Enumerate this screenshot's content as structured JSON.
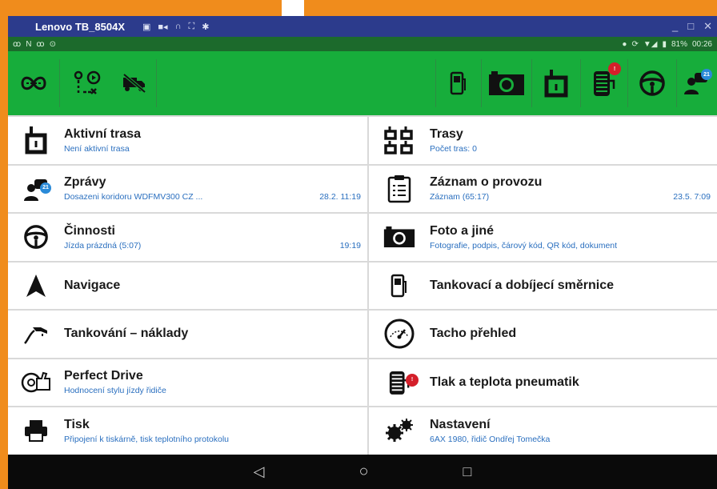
{
  "window": {
    "title": "Lenovo TB_8504X",
    "controls": [
      "_",
      "□",
      "✕"
    ]
  },
  "status": {
    "left_icons": [
      "ꝏ",
      "N",
      "ꝏ",
      "⊙"
    ],
    "battery": "81%",
    "time": "00:26"
  },
  "toolbar": {
    "left": [
      "route-icon",
      "route-planner-icon",
      "no-truck-icon"
    ],
    "right": [
      "fuel-pump-icon",
      "camera-icon",
      "route-icon",
      "tire-icon",
      "steering-wheel-icon",
      "messages-icon"
    ],
    "messages_badge": "21",
    "tire_badge": "!"
  },
  "menu_left": [
    {
      "title": "Aktivní trasa",
      "sub": "Není aktivní trasa",
      "time": "",
      "icon": "route-icon"
    },
    {
      "title": "Zprávy",
      "sub": "Dosazeni koridoru WDFMV300 CZ ...",
      "time": "28.2. 11:19",
      "icon": "messages-icon",
      "badge": "21"
    },
    {
      "title": "Činnosti",
      "sub": "Jízda prázdná (5:07)",
      "time": "19:19",
      "icon": "steering-wheel-icon"
    },
    {
      "title": "Navigace",
      "sub": "",
      "time": "",
      "icon": "navigation-arrow-icon"
    },
    {
      "title": "Tankování – náklady",
      "sub": "",
      "time": "",
      "icon": "fuel-nozzle-icon"
    },
    {
      "title": "Perfect Drive",
      "sub": "Hodnocení stylu jízdy řidiče",
      "time": "",
      "icon": "perfect-drive-icon"
    },
    {
      "title": "Tisk",
      "sub": "Připojení k tiskárně, tisk teplotního protokolu",
      "time": "",
      "icon": "printer-icon"
    }
  ],
  "menu_right": [
    {
      "title": "Trasy",
      "sub": "Počet tras: 0",
      "time": "",
      "icon": "routes-icon"
    },
    {
      "title": "Záznam o provozu",
      "sub": "Záznam (65:17)",
      "time": "23.5. 7:09",
      "icon": "clipboard-icon"
    },
    {
      "title": "Foto a jiné",
      "sub": "Fotografie, podpis, čárový kód, QR kód, dokument",
      "time": "",
      "icon": "camera-icon"
    },
    {
      "title": "Tankovací a dobíjecí směrnice",
      "sub": "",
      "time": "",
      "icon": "fuel-pump-icon"
    },
    {
      "title": "Tacho přehled",
      "sub": "",
      "time": "",
      "icon": "tachometer-icon"
    },
    {
      "title": "Tlak a teplota pneumatik",
      "sub": "",
      "time": "",
      "icon": "tire-icon",
      "badge": "!"
    },
    {
      "title": "Nastavení",
      "sub": "6AX 1980, řidič Ondřej Tomečka",
      "time": "",
      "icon": "settings-gears-icon"
    }
  ],
  "navbar": {
    "back": "◁",
    "home": "○",
    "recents": "□"
  },
  "colors": {
    "toolbar": "#17ad3b",
    "window_bar": "#2c3b8c",
    "subtitle": "#2a6fbf"
  }
}
